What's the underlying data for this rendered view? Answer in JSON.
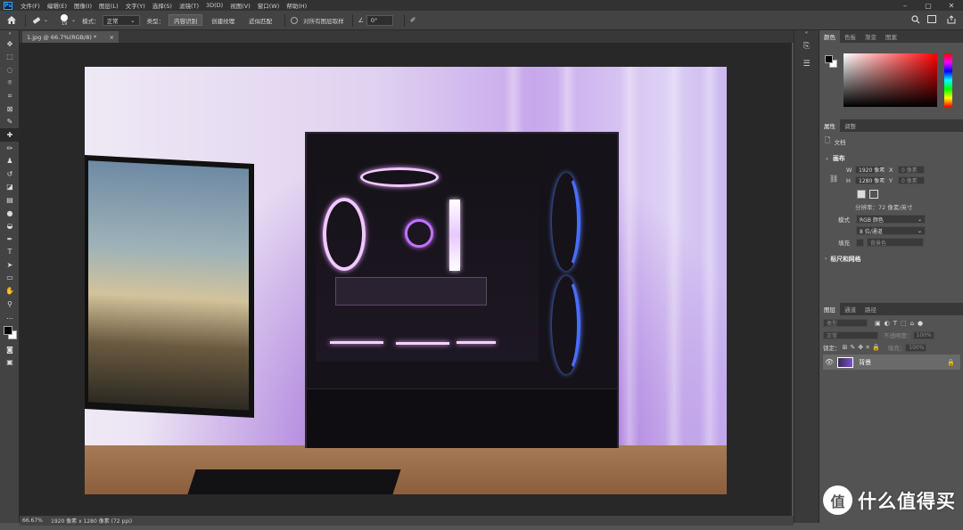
{
  "app": {
    "logo": "Ps"
  },
  "menu": [
    "文件(F)",
    "编辑(E)",
    "图像(I)",
    "图层(L)",
    "文字(Y)",
    "选择(S)",
    "滤镜(T)",
    "3D(D)",
    "视图(V)",
    "窗口(W)",
    "帮助(H)"
  ],
  "options": {
    "brush_size": "19",
    "mode_label": "模式：",
    "mode_value": "正常",
    "type_label": "类型：",
    "btn_content_aware": "内容识别",
    "btn_create_texture": "创建纹理",
    "btn_proximity_match": "近似匹配",
    "sample_all_layers": "对所有图层取样",
    "angle": "0°"
  },
  "tab": {
    "label": "1.jpg @ 66.7%(RGB/8) *",
    "close": "×"
  },
  "status": {
    "zoom": "66.67%",
    "info": "1920 像素 x 1280 像素 (72 ppi)"
  },
  "panels": {
    "color_tabs": [
      "颜色",
      "色板",
      "渐变",
      "图案"
    ],
    "props_tabs": [
      "属性",
      "调整"
    ],
    "doc_label": "文档",
    "canvas_title": "画布",
    "w_label": "W",
    "w_value": "1920 像素",
    "h_label": "H",
    "h_value": "1280 像素",
    "x_label": "X",
    "x_value": "0 像素",
    "y_label": "Y",
    "y_value": "0 像素",
    "resolution": "分辨率：72 像素/英寸",
    "mode_label": "模式",
    "mode_value": "RGB 颜色",
    "depth_value": "8 位/通道",
    "fill_label": "填充",
    "fill_value": "背景色",
    "rulers_title": "标尺和网格",
    "layers_tabs": [
      "图层",
      "通道",
      "路径"
    ],
    "filter_kind": "类型",
    "blend_mode": "正常",
    "opacity_label": "不透明度：",
    "opacity_value": "100%",
    "lock_label": "锁定：",
    "fill_pct_label": "填充：",
    "fill_pct_value": "100%",
    "layer_name": "背景"
  },
  "watermark": {
    "icon": "值",
    "text": "什么值得买"
  },
  "colors": {
    "menubar": "#323232",
    "panel": "#535353",
    "canvas_bg": "#282828",
    "accent": "#31a8ff"
  }
}
